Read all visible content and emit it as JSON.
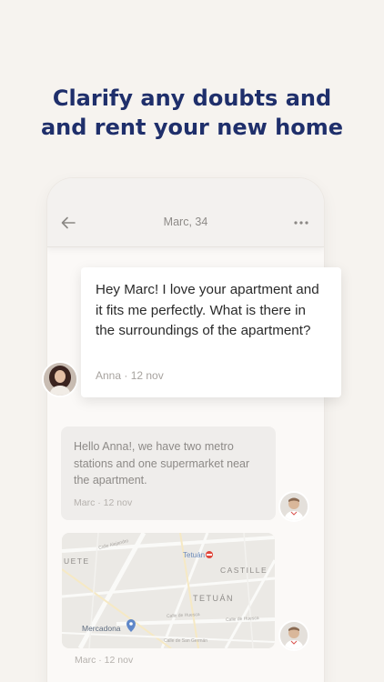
{
  "headline": {
    "line1": "Clarify any doubts and",
    "line2": "and rent your new home"
  },
  "chat": {
    "title": "Marc, 34",
    "icons": {
      "back": "arrow-left-icon",
      "more": "more-dots-icon"
    }
  },
  "messages": {
    "anna": {
      "text": "Hey Marc! I love your apartment and it fits me perfectly. What is there in the surroundings of the apartment?",
      "meta": "Anna · 12 nov"
    },
    "marc_reply": {
      "text": "Hello Anna!, we have two metro stations and one supermarket near the apartment.",
      "meta": "Marc · 12 nov"
    },
    "marc_map": {
      "meta": "Marc · 12 nov",
      "labels": {
        "tetuan_station": "Tetuán",
        "uete": "UETE",
        "castille": "CASTILLE",
        "tetuan_district": "TETUÁN",
        "mercadona": "Mercadona",
        "calle_huesca_1": "Calle de Huesca",
        "calle_huesca_2": "Calle de Huesca",
        "calle_san_germán": "Calle de San Germán",
        "calle_alejandro": "Calle Alejandro"
      }
    }
  },
  "colors": {
    "background": "#f6f3ef",
    "headline": "#1f2f6b",
    "metro": "#e0453a"
  }
}
